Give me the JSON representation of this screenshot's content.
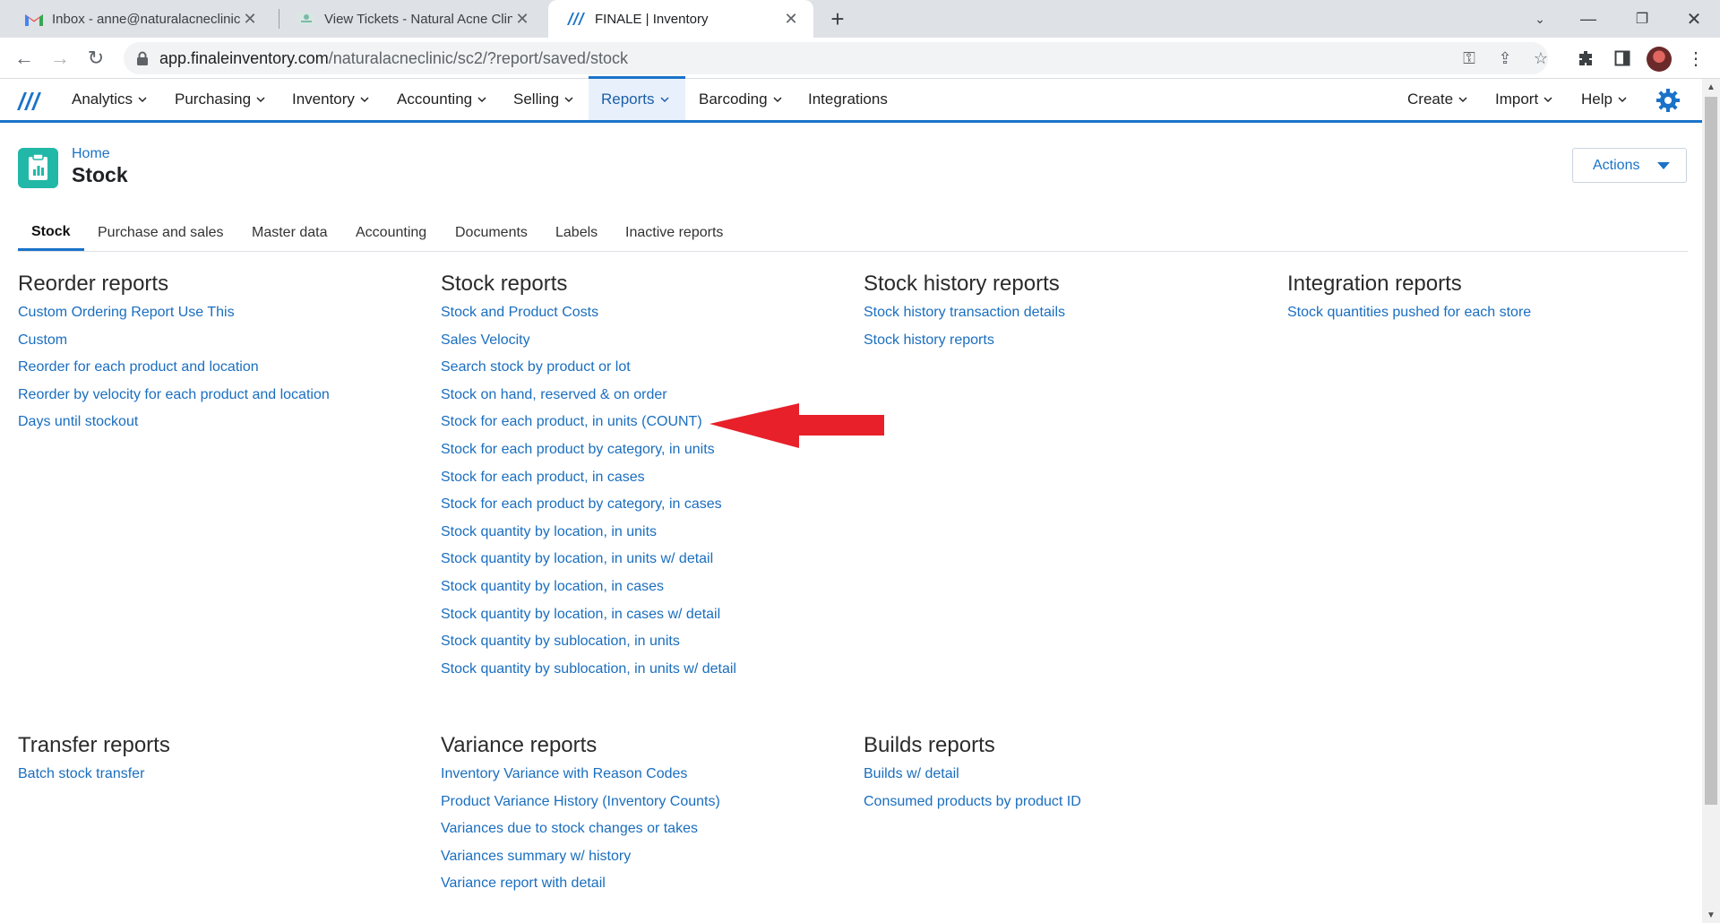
{
  "browser": {
    "tabs": [
      {
        "title": "Inbox - anne@naturalacneclinic.c",
        "icon": "gmail-icon"
      },
      {
        "title": "View Tickets - Natural Acne Clinic",
        "icon": "helpdesk-icon"
      },
      {
        "title": "FINALE | Inventory",
        "icon": "finale-logo-icon"
      }
    ],
    "url_host": "app.finaleinventory.com",
    "url_path": "/naturalacneclinic/sc2/?report/saved/stock",
    "colors": {
      "tabstrip": "#dee1e6",
      "omnibox": "#f1f3f4"
    }
  },
  "nav": {
    "left": [
      "Analytics",
      "Purchasing",
      "Inventory",
      "Accounting",
      "Selling",
      "Reports",
      "Barcoding",
      "Integrations"
    ],
    "right": [
      "Create",
      "Import",
      "Help"
    ],
    "active": "Reports",
    "accent": "#1a73c8"
  },
  "page": {
    "breadcrumb": "Home",
    "title": "Stock",
    "actions_label": "Actions",
    "icon_color": "#22b8a8"
  },
  "subtabs": [
    "Stock",
    "Purchase and sales",
    "Master data",
    "Accounting",
    "Documents",
    "Labels",
    "Inactive reports"
  ],
  "groups": {
    "reorder": {
      "title": "Reorder reports",
      "items": [
        "Custom Ordering Report Use This",
        "Custom",
        "Reorder for each product and location",
        "Reorder by velocity for each product and location",
        "Days until stockout"
      ]
    },
    "stock": {
      "title": "Stock reports",
      "items": [
        "Stock and Product Costs",
        "Sales Velocity",
        "Search stock by product or lot",
        "Stock on hand, reserved & on order",
        "Stock for each product, in units (COUNT)",
        "Stock for each product by category, in units",
        "Stock for each product, in cases",
        "Stock for each product by category, in cases",
        "Stock quantity by location, in units",
        "Stock quantity by location, in units w/ detail",
        "Stock quantity by location, in cases",
        "Stock quantity by location, in cases w/ detail",
        "Stock quantity by sublocation, in units",
        "Stock quantity by sublocation, in units w/ detail"
      ]
    },
    "history": {
      "title": "Stock history reports",
      "items": [
        "Stock history transaction details",
        "Stock history reports"
      ]
    },
    "integration": {
      "title": "Integration reports",
      "items": [
        "Stock quantities pushed for each store"
      ]
    },
    "transfer": {
      "title": "Transfer reports",
      "items": [
        "Batch stock transfer"
      ]
    },
    "variance": {
      "title": "Variance reports",
      "items": [
        "Inventory Variance with Reason Codes",
        "Product Variance History (Inventory Counts)",
        "Variances due to stock changes or takes",
        "Variances summary w/ history",
        "Variance report with detail"
      ]
    },
    "builds": {
      "title": "Builds reports",
      "items": [
        "Builds w/ detail",
        "Consumed products by product ID"
      ]
    }
  },
  "annotation": {
    "color": "#e8202a",
    "points_to": "Stock for each product, in units (COUNT)"
  }
}
